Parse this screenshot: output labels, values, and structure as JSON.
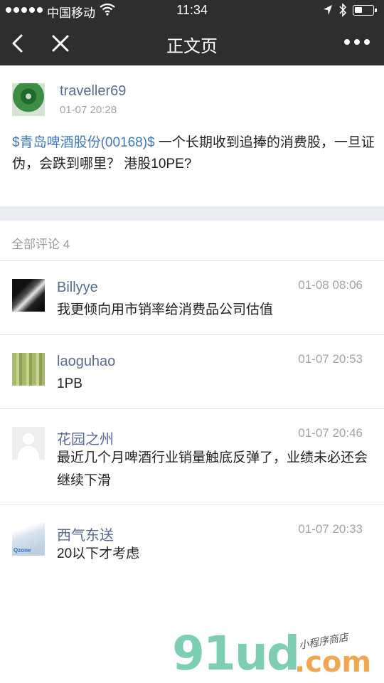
{
  "status_bar": {
    "carrier": "中国移动",
    "time": "11:34"
  },
  "navbar": {
    "title": "正文页"
  },
  "post": {
    "username": "traveller69",
    "timestamp": "01-07 20:28",
    "stock_tag": "$青岛啤酒股份(00168)$",
    "body": " 一个长期收到追捧的消费股，一旦证伪，会跌到哪里？ 港股10PE?"
  },
  "comments_header": "全部评论 4",
  "comments": [
    {
      "username": "Billyye",
      "time": "01-08 08:06",
      "text": "我更倾向用市销率给消费品公司估值"
    },
    {
      "username": "laoguhao",
      "time": "01-07 20:53",
      "text": "1PB"
    },
    {
      "username": "花园之州",
      "time": "01-07 20:46",
      "text": "最近几个月啤酒行业销量触底反弹了，业绩未必还会继续下滑"
    },
    {
      "username": "西气东送",
      "time": "01-07 20:33",
      "text": "20以下才考虑"
    }
  ],
  "watermark": {
    "logo": "91ud",
    "domain": ".com",
    "tagline": "小程序商店"
  },
  "colors": {
    "nav_bg": "#2e2e2e",
    "username": "#586b95",
    "stock_link": "#3e79c2",
    "timestamp": "#a3a3a3"
  }
}
